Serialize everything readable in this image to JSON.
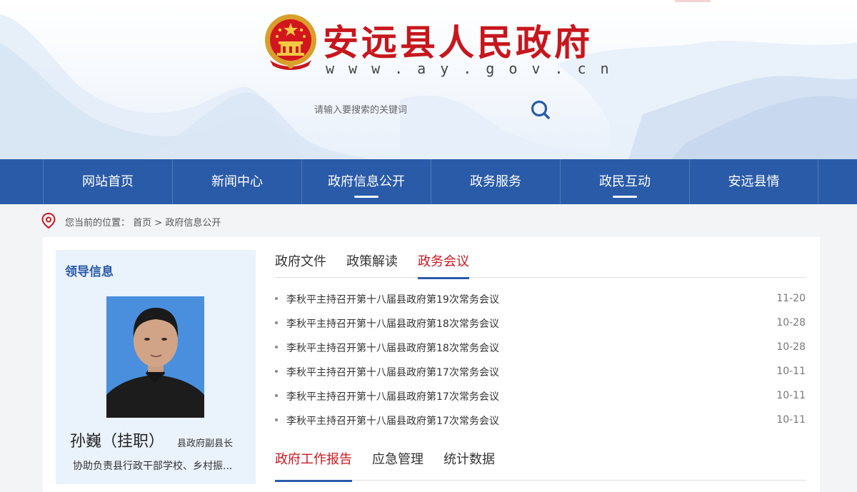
{
  "site": {
    "title": "安远县人民政府",
    "url": "www.ay.gov.cn"
  },
  "search": {
    "placeholder": "请输入要搜索的关键词"
  },
  "nav": {
    "items": [
      {
        "label": "网站首页",
        "active": false
      },
      {
        "label": "新闻中心",
        "active": false
      },
      {
        "label": "政府信息公开",
        "active": true
      },
      {
        "label": "政务服务",
        "active": false
      },
      {
        "label": "政民互动",
        "active": true
      },
      {
        "label": "安远县情",
        "active": false
      }
    ]
  },
  "breadcrumb": {
    "prefix": "您当前的位置：",
    "home": "首页",
    "separator": " > ",
    "current": "政府信息公开"
  },
  "leader": {
    "section_title": "领导信息",
    "name": "孙巍（挂职）",
    "position": "县政府副县长",
    "duty": "协助负责县行政干部学校、乡村振..."
  },
  "tabs_top": {
    "items": [
      "政府文件",
      "政策解读",
      "政务会议"
    ],
    "active": 2
  },
  "news": [
    {
      "title": "李秋平主持召开第十八届县政府第19次常务会议",
      "date": "11-20"
    },
    {
      "title": "李秋平主持召开第十八届县政府第18次常务会议",
      "date": "10-28"
    },
    {
      "title": "李秋平主持召开第十八届县政府第18次常务会议",
      "date": "10-28"
    },
    {
      "title": "李秋平主持召开第十八届县政府第17次常务会议",
      "date": "10-11"
    },
    {
      "title": "李秋平主持召开第十八届县政府第17次常务会议",
      "date": "10-11"
    },
    {
      "title": "李秋平主持召开第十八届县政府第17次常务会议",
      "date": "10-11"
    }
  ],
  "tabs_bottom": {
    "items": [
      "政府工作报告",
      "应急管理",
      "统计数据"
    ],
    "active": 0
  },
  "colors": {
    "brand_red": "#c8161d",
    "nav_blue": "#2a5ba8",
    "card_bg": "#eaf2fc"
  },
  "icons": {
    "search": "search-icon",
    "location": "location-pin-icon",
    "emblem": "national-emblem-icon"
  }
}
